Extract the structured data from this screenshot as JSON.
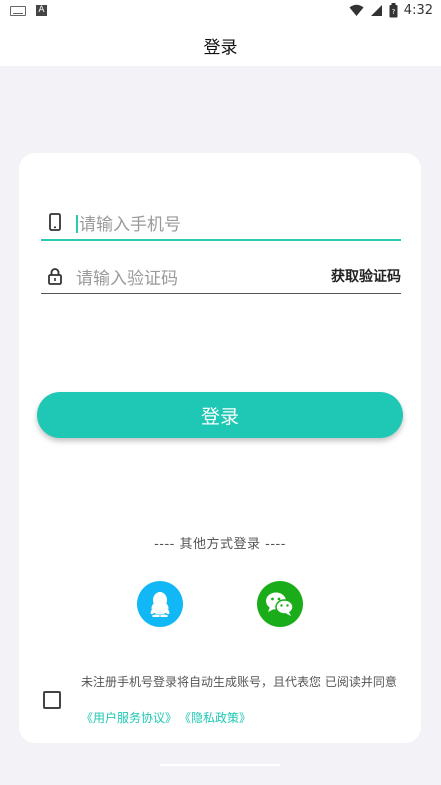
{
  "status_bar": {
    "time": "4:32",
    "notif_letter": "A"
  },
  "header": {
    "title": "登录"
  },
  "form": {
    "phone_placeholder": "请输入手机号",
    "code_placeholder": "请输入验证码",
    "get_code_label": "获取验证码",
    "login_label": "登录"
  },
  "other_login": {
    "label": "---- 其他方式登录 ----"
  },
  "agreement": {
    "text": "未注册手机号登录将自动生成账号，且代表您 已阅读并同意",
    "user_agreement": "《用户服务协议》",
    "privacy_policy": "《隐私政策》"
  },
  "colors": {
    "accent": "#1ec8b4",
    "qq": "#12b7f5",
    "wechat": "#1aad19"
  }
}
